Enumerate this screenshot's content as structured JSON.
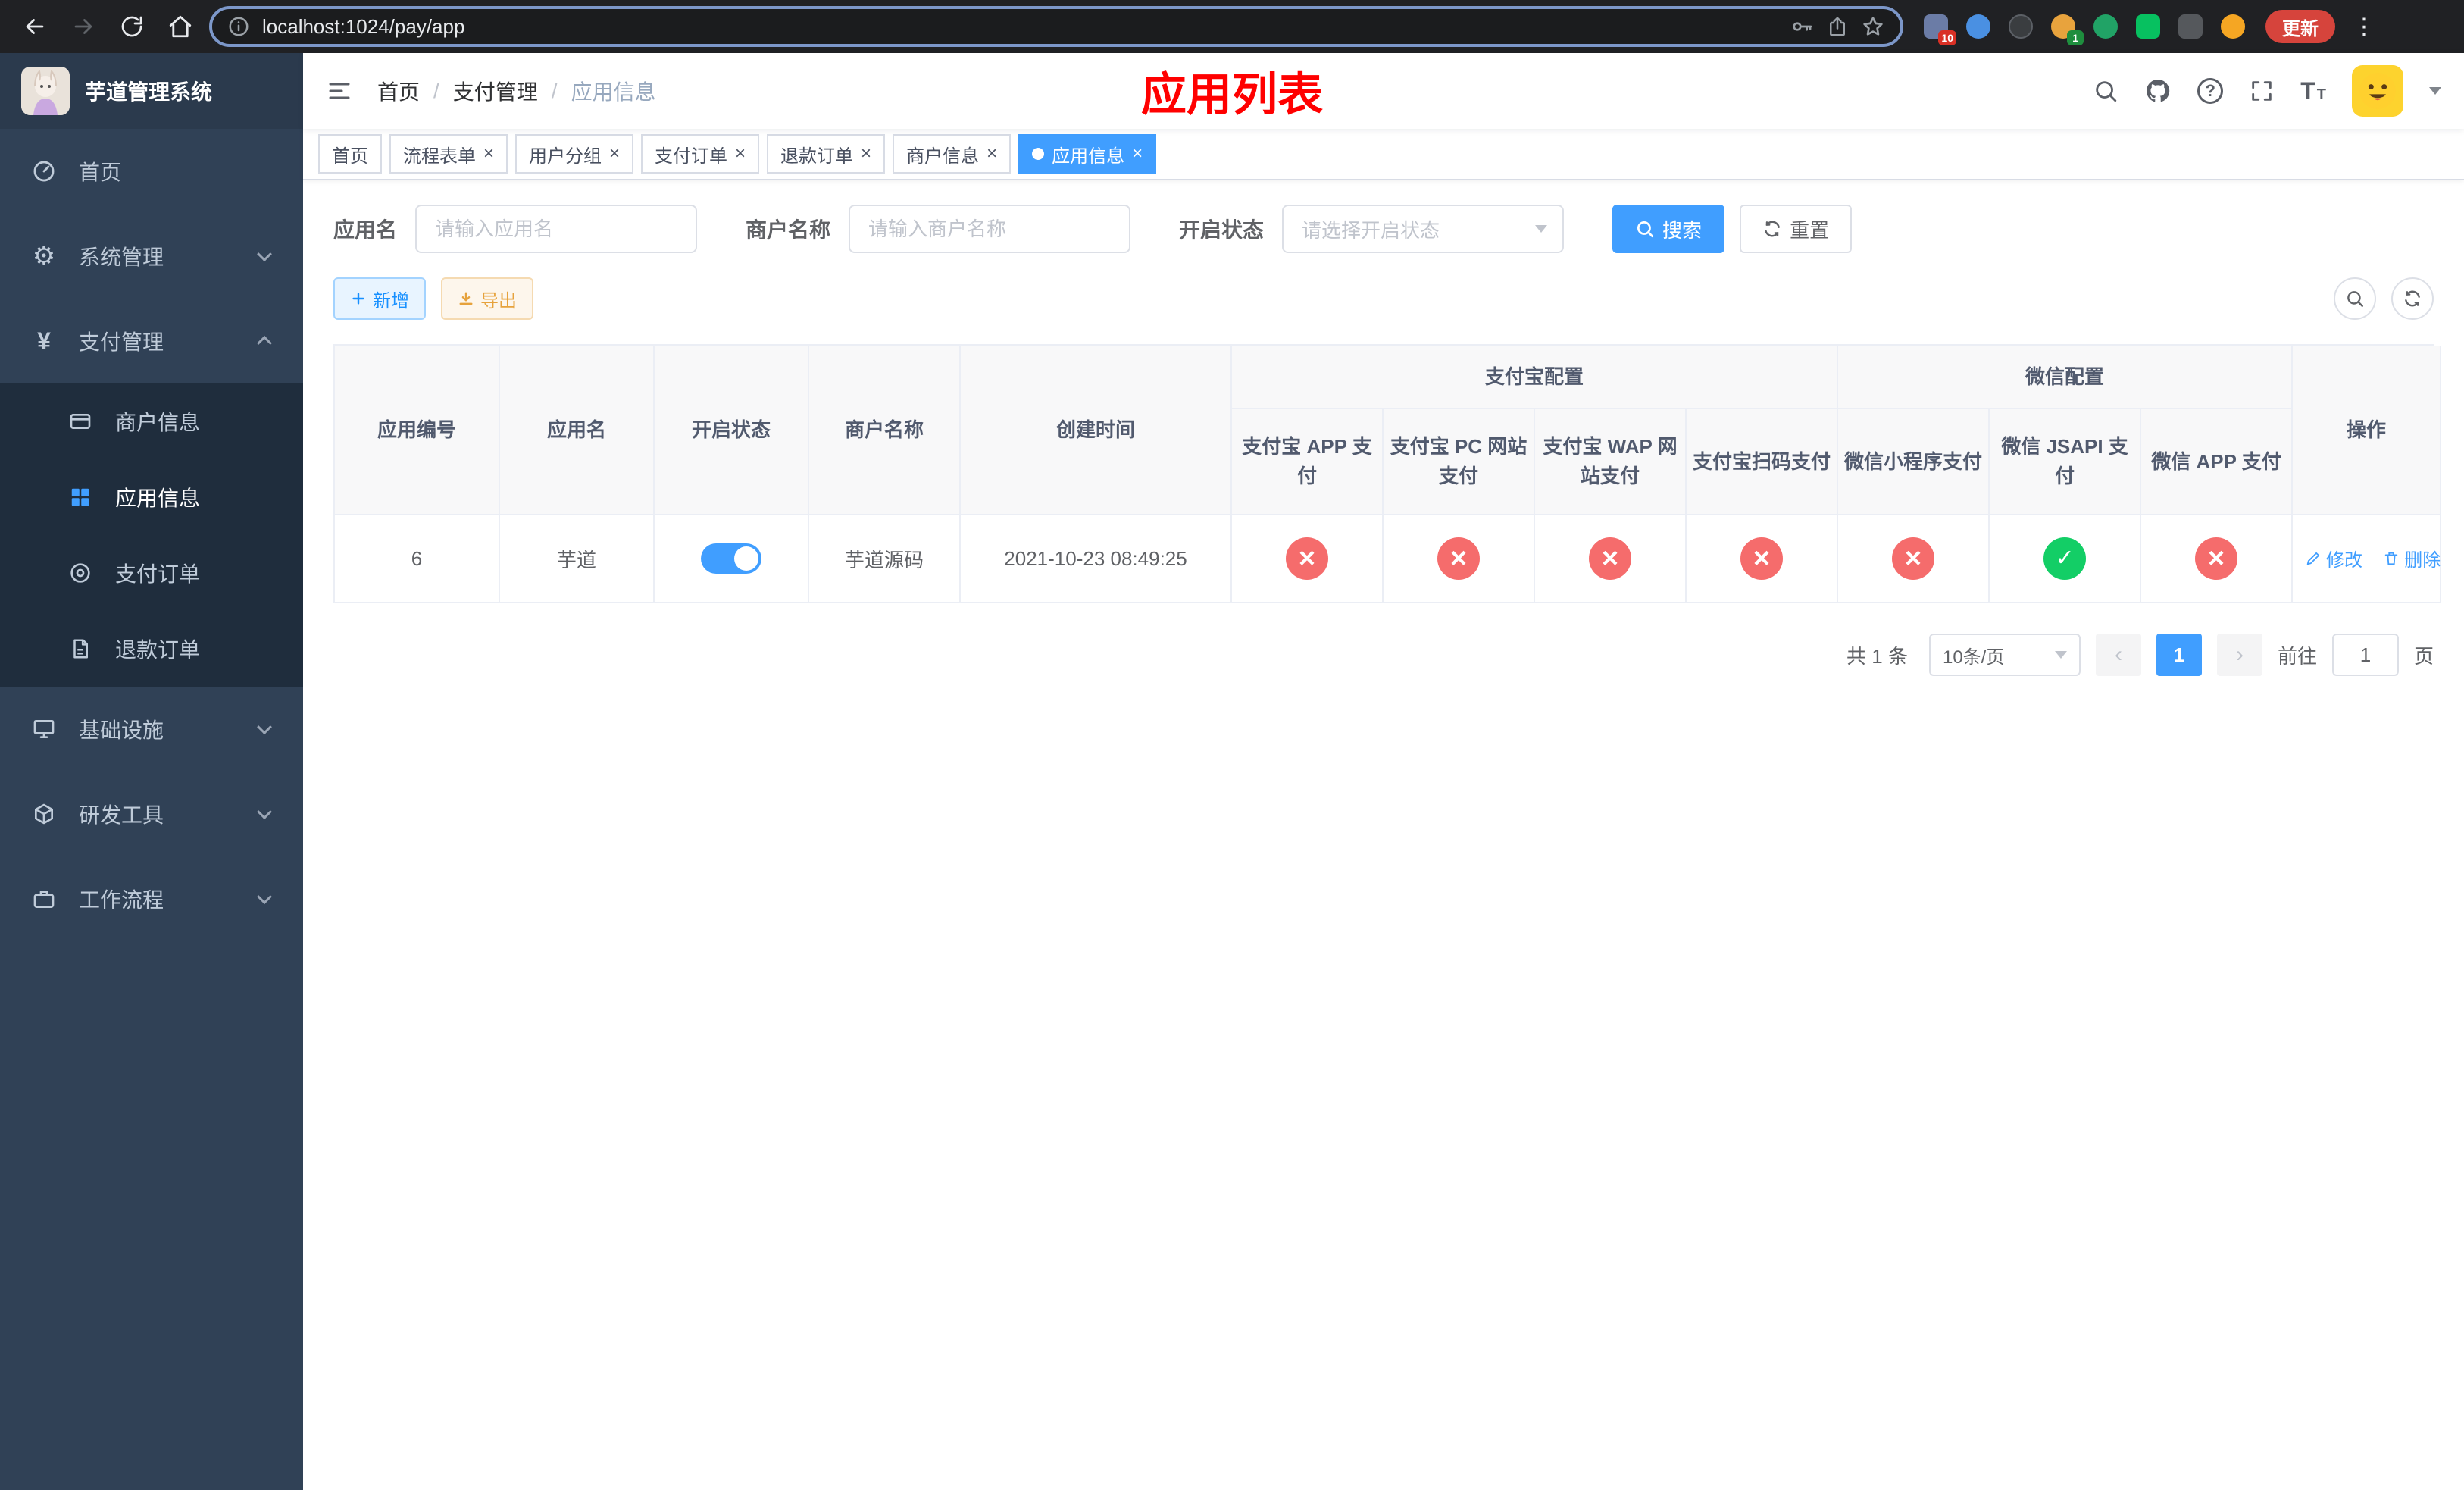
{
  "browser": {
    "url": "localhost:1024/pay/app",
    "update_label": "更新",
    "badge_puzzle": "10",
    "badge_avatar": "1"
  },
  "colors": {
    "accent": "#409eff",
    "danger": "#f56c6c",
    "success": "#13ce66",
    "warning": "#e6a23c",
    "annotation_red": "#ff0000",
    "sidebar_bg": "#304156"
  },
  "sidebar": {
    "title": "芋道管理系统",
    "items": [
      {
        "label": "首页"
      },
      {
        "label": "系统管理"
      },
      {
        "label": "支付管理",
        "children": [
          {
            "label": "商户信息"
          },
          {
            "label": "应用信息"
          },
          {
            "label": "支付订单"
          },
          {
            "label": "退款订单"
          }
        ]
      },
      {
        "label": "基础设施"
      },
      {
        "label": "研发工具"
      },
      {
        "label": "工作流程"
      }
    ]
  },
  "header": {
    "breadcrumb": [
      "首页",
      "支付管理",
      "应用信息"
    ],
    "annotation": "应用列表"
  },
  "tabs": [
    {
      "label": "首页"
    },
    {
      "label": "流程表单"
    },
    {
      "label": "用户分组"
    },
    {
      "label": "支付订单"
    },
    {
      "label": "退款订单"
    },
    {
      "label": "商户信息"
    },
    {
      "label": "应用信息"
    }
  ],
  "filters": {
    "app_name_label": "应用名",
    "app_name_placeholder": "请输入应用名",
    "merchant_label": "商户名称",
    "merchant_placeholder": "请输入商户名称",
    "status_label": "开启状态",
    "status_placeholder": "请选择开启状态",
    "search_label": "搜索",
    "reset_label": "重置"
  },
  "toolbar": {
    "add_label": "新增",
    "export_label": "导出"
  },
  "table": {
    "columns": {
      "id": "应用编号",
      "name": "应用名",
      "status": "开启状态",
      "merchant": "商户名称",
      "created": "创建时间",
      "alipay_group": "支付宝配置",
      "wechat_group": "微信配置",
      "alipay_app": "支付宝 APP 支付",
      "alipay_pc": "支付宝 PC 网站支付",
      "alipay_wap": "支付宝 WAP 网站支付",
      "alipay_qr": "支付宝扫码支付",
      "wx_lite": "微信小程序支付",
      "wx_jsapi": "微信 JSAPI 支付",
      "wx_app": "微信 APP 支付",
      "actions": "操作"
    },
    "rows": [
      {
        "id": "6",
        "name": "芋道",
        "enabled": true,
        "merchant": "芋道源码",
        "created_at": "2021-10-23 08:49:25",
        "alipay_app": false,
        "alipay_pc": false,
        "alipay_wap": false,
        "alipay_qr": false,
        "wx_lite": false,
        "wx_jsapi": true,
        "wx_app": false,
        "edit_label": "修改",
        "delete_label": "删除"
      }
    ]
  },
  "pagination": {
    "total": "共 1 条",
    "page_size": "10条/页",
    "page": "1",
    "goto_label": "前往",
    "goto_value": "1",
    "unit": "页"
  }
}
